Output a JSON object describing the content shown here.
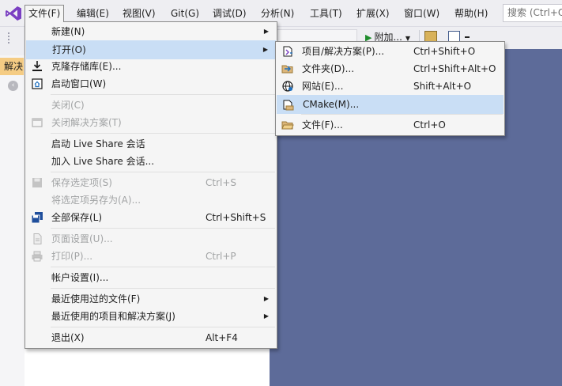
{
  "menubar": {
    "items": [
      {
        "label": "文件(F)"
      },
      {
        "label": "编辑(E)"
      },
      {
        "label": "视图(V)"
      },
      {
        "label": "Git(G)"
      },
      {
        "label": "调试(D)"
      },
      {
        "label": "分析(N)"
      },
      {
        "label": "工具(T)"
      },
      {
        "label": "扩展(X)"
      },
      {
        "label": "窗口(W)"
      },
      {
        "label": "帮助(H)"
      }
    ],
    "search_placeholder": "搜索 (Ctrl+Q)"
  },
  "toolbar": {
    "attach_label": "附加..."
  },
  "left_panel": {
    "tab_label": "解决"
  },
  "file_menu": {
    "items": [
      {
        "label": "新建(N)",
        "icon": "none",
        "submenu": true
      },
      {
        "label": "打开(O)",
        "icon": "none",
        "submenu": true,
        "highlighted": true
      },
      {
        "label": "克隆存储库(E)...",
        "icon": "clone-repo-icon"
      },
      {
        "label": "启动窗口(W)",
        "icon": "start-window-icon"
      },
      {
        "label": "关闭(C)",
        "disabled": true
      },
      {
        "label": "关闭解决方案(T)",
        "disabled": true,
        "icon": "close-solution-icon"
      },
      {
        "label": "启动 Live Share 会话"
      },
      {
        "label": "加入 Live Share 会话..."
      },
      {
        "label": "保存选定项(S)",
        "shortcut": "Ctrl+S",
        "disabled": true,
        "icon": "save-icon"
      },
      {
        "label": "将选定项另存为(A)...",
        "disabled": true
      },
      {
        "label": "全部保存(L)",
        "shortcut": "Ctrl+Shift+S",
        "icon": "save-all-icon"
      },
      {
        "label": "页面设置(U)...",
        "disabled": true,
        "icon": "page-setup-icon"
      },
      {
        "label": "打印(P)...",
        "shortcut": "Ctrl+P",
        "disabled": true,
        "icon": "print-icon"
      },
      {
        "label": "帐户设置(I)..."
      },
      {
        "label": "最近使用过的文件(F)",
        "submenu": true
      },
      {
        "label": "最近使用的项目和解决方案(J)",
        "submenu": true
      },
      {
        "label": "退出(X)",
        "shortcut": "Alt+F4"
      }
    ]
  },
  "open_submenu": {
    "items": [
      {
        "label": "项目/解决方案(P)...",
        "shortcut": "Ctrl+Shift+O",
        "icon": "open-project-icon"
      },
      {
        "label": "文件夹(D)...",
        "shortcut": "Ctrl+Shift+Alt+O",
        "icon": "open-folder-icon"
      },
      {
        "label": "网站(E)...",
        "shortcut": "Shift+Alt+O",
        "icon": "globe-icon"
      },
      {
        "label": "CMake(M)...",
        "icon": "cmake-icon",
        "highlighted": true
      },
      {
        "label": "文件(F)...",
        "shortcut": "Ctrl+O",
        "icon": "open-file-icon"
      }
    ]
  },
  "colors": {
    "menu_background": "#f5f5f5",
    "highlight": "#c9def5",
    "editor_background": "#5d6b99",
    "disabled_text": "#a2a4a5",
    "left_tab": "#f5cc84"
  }
}
